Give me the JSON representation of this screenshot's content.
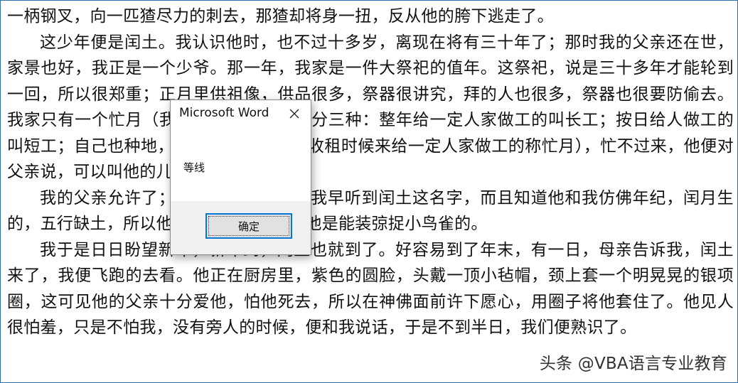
{
  "document": {
    "paragraphs": [
      "一柄钢叉，向一匹猹尽力的刺去，那猹却将身一扭，反从他的胯下逃走了。",
      "这少年便是闰土。我认识他时，也不过十多岁，离现在将有三十年了；那时我的父亲还在世，家景也好，我正是一个少爷。那一年，我家是一件大祭祀的值年。这祭祀，说是三十多年才能轮到一回，所以很郑重；正月里供祖像，供品很多，祭器很讲究，拜的人也很多，祭器也很要防偷去。我家只有一个忙月（我们这里给人做工的分三种：整年给一定人家做工的叫长工；按日给人做工的叫短工；自己也种地，只在过年过节以及收租时候来给一定人家做工的称忙月），忙不过来，他便对父亲说，可以叫他的儿子闰土来管祭器的。",
      "我的父亲允许了；我也很高兴，因为我早听到闰土这名字，而且知道他和我仿佛年纪，闰月生的，五行缺土，所以他的父亲叫他闰土。他是能装弶捉小鸟雀的。",
      "我于是日日盼望新年，新年到，闰土也就到了。好容易到了年末，有一日，母亲告诉我，闰土来了，我便飞跑的去看。他正在厨房里，紫色的圆脸，头戴一顶小毡帽，颈上套一个明晃晃的银项圈，这可见他的父亲十分爱他，怕他死去，所以在神佛面前许下愿心，用圈子将他套住了。他见人很怕羞，只是不怕我，没有旁人的时候，便和我说话，于是不到半日，我们便熟识了。"
    ]
  },
  "dialog": {
    "title": "Microsoft Word",
    "message": "等线",
    "ok_label": "确定",
    "close_icon": "close-icon"
  },
  "watermark": "头条 @VBA语言专业教育",
  "colors": {
    "frame_border": "#2e6fb4",
    "button_focus": "#0078d7",
    "dialog_footer": "#f0f0f0"
  }
}
